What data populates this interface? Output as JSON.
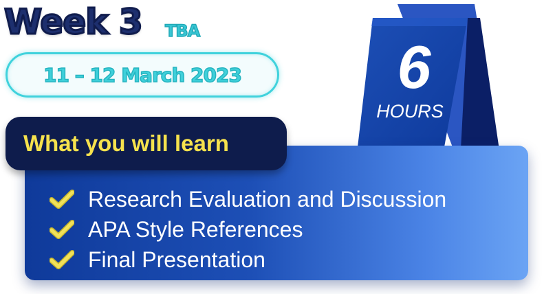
{
  "header": {
    "week": "Week 3",
    "tag": "TBA",
    "dates": "11 – 12 March 2023"
  },
  "hours": {
    "number": "6",
    "unit": "HOURS"
  },
  "learn": {
    "heading": "What you will learn",
    "topics": [
      "Research Evaluation and Discussion",
      "APA Style References",
      "Final Presentation"
    ]
  },
  "colors": {
    "navy": "#101c4d",
    "teal": "#40d2dc",
    "yellow": "#f6e24d",
    "panel_start": "#0f3a9a",
    "panel_end": "#6ba4f4",
    "check_fill": "#f1e15a"
  },
  "icons": {
    "topic_bullet": "check-icon",
    "hours_card": "desk-calendar-icon"
  }
}
